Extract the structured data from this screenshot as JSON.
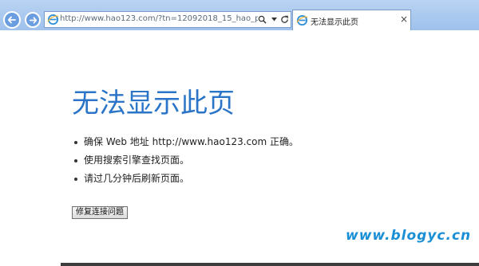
{
  "browser": {
    "address_url": "http://www.hao123.com/?tn=12092018_15_hao_pg",
    "tab_title": "无法显示此页",
    "tab_close_glyph": "×",
    "icons": [
      "back-icon",
      "forward-icon",
      "ie-icon",
      "search-icon",
      "dropdown-icon",
      "refresh-icon",
      "close-icon"
    ]
  },
  "page": {
    "title": "无法显示此页",
    "tips": [
      "确保 Web 地址 http://www.hao123.com 正确。",
      "使用搜索引擎查找页面。",
      "请过几分钟后刷新页面。"
    ],
    "fix_button": "修复连接问题",
    "watermark": "www.blogyc.cn"
  },
  "colors": {
    "title": "#2a75c7",
    "chrome": "#9ec1ec",
    "watermark": "#1a8fd6"
  }
}
